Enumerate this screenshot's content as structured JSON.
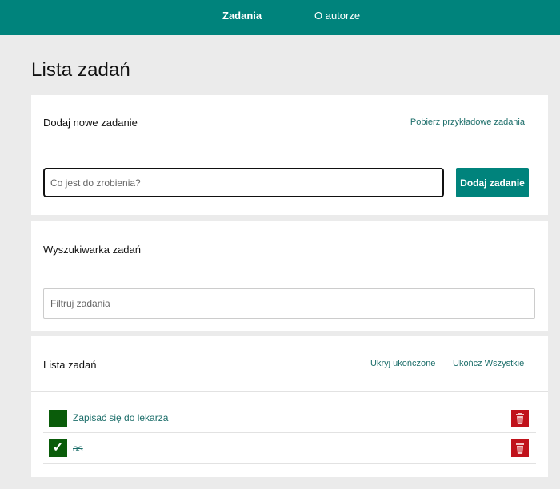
{
  "nav": {
    "items": [
      {
        "label": "Zadania",
        "active": true
      },
      {
        "label": "O autorze",
        "active": false
      }
    ],
    "background": "#00837c"
  },
  "page": {
    "title": "Lista zadań"
  },
  "add_card": {
    "title": "Dodaj nowe zadanie",
    "sample_link": "Pobierz przykładowe zadania",
    "input_placeholder": "Co jest do zrobienia?",
    "input_value": "",
    "button_label": "Dodaj zadanie"
  },
  "search_card": {
    "title": "Wyszukiwarka zadań",
    "input_placeholder": "Filtruj zadania",
    "input_value": ""
  },
  "list_card": {
    "title": "Lista zadań",
    "hide_link": "Ukryj ukończone",
    "complete_all_link": "Ukończ Wszystkie",
    "tasks": [
      {
        "text": "Zapisać się do lekarza",
        "done": false
      },
      {
        "text": "as",
        "done": true
      }
    ]
  },
  "colors": {
    "accent": "#00837c",
    "checkbox": "#0a5c0a",
    "delete": "#c0121b",
    "link": "#1c6e6a"
  },
  "icons": {
    "check": "check-icon",
    "delete": "trash-icon"
  }
}
